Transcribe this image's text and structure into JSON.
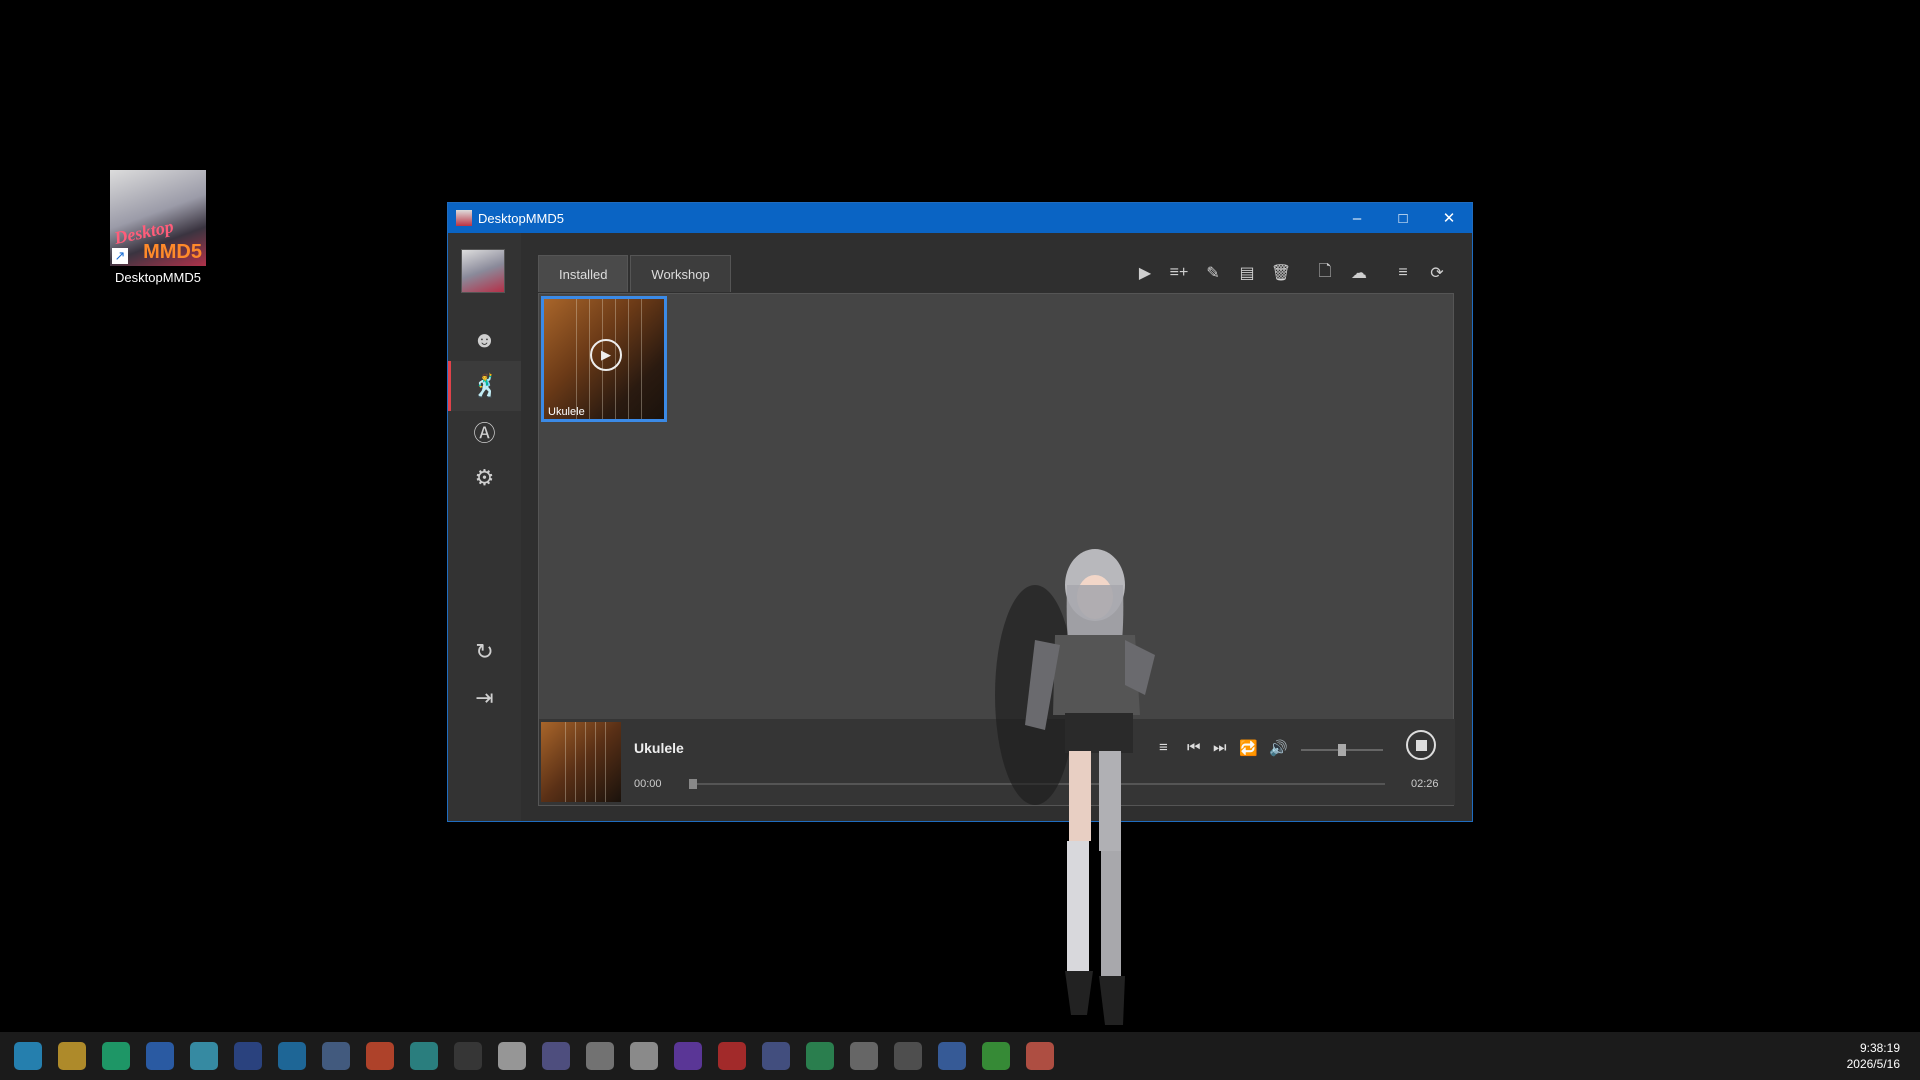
{
  "desktop": {
    "icon_label": "DesktopMMD5",
    "icon_logo_top": "Desktop",
    "icon_logo_bottom": "MMD5"
  },
  "window": {
    "title": "DesktopMMD5",
    "controls": {
      "minimize": "–",
      "maximize": "□",
      "close": "✕"
    }
  },
  "sidebar": {
    "items": [
      {
        "name": "face-icon",
        "glyph": "☻"
      },
      {
        "name": "dance-icon",
        "glyph": "🕺"
      },
      {
        "name": "motion-icon",
        "glyph": "Ⓐ"
      },
      {
        "name": "gear-icon",
        "glyph": "⚙"
      },
      {
        "name": "refresh-icon",
        "glyph": "↻"
      },
      {
        "name": "exit-icon",
        "glyph": "⇥"
      }
    ],
    "active_item": "dance-icon"
  },
  "tabs": [
    {
      "label": "Installed",
      "active": true
    },
    {
      "label": "Workshop",
      "active": false
    }
  ],
  "toolbar": {
    "play": "▶",
    "add_to_playlist": "≡+",
    "edit": "✎",
    "open_folder": "▤",
    "delete": "🗑",
    "new_file": "🗋",
    "upload": "☁",
    "playlist": "≡",
    "refresh": "⟳"
  },
  "library": {
    "items": [
      {
        "name": "Ukulele",
        "selected": true
      }
    ]
  },
  "player": {
    "track": "Ukulele",
    "elapsed": "00:00",
    "duration": "02:26",
    "progress": 0,
    "volume": 0.5,
    "controls": {
      "playlist": "≡",
      "prev": "⏮",
      "next": "⏭",
      "repeat": "🔁",
      "volume": "🔊"
    }
  },
  "taskbar": {
    "time": "9:38:19",
    "date": "2026/5/16",
    "app_colors": [
      "#2aa1e0",
      "#e0b030",
      "#20c080",
      "#3070d0",
      "#40b0d0",
      "#3050a0",
      "#2080c0",
      "#5070a0",
      "#e05030",
      "#30a0a0",
      "#404040",
      "#c0c0c0",
      "#6060a0",
      "#909090",
      "#b0b0b0",
      "#7040c0",
      "#d03030",
      "#5060a0",
      "#30a060",
      "#808080",
      "#606060",
      "#4070c0",
      "#40b040",
      "#e06050"
    ]
  }
}
